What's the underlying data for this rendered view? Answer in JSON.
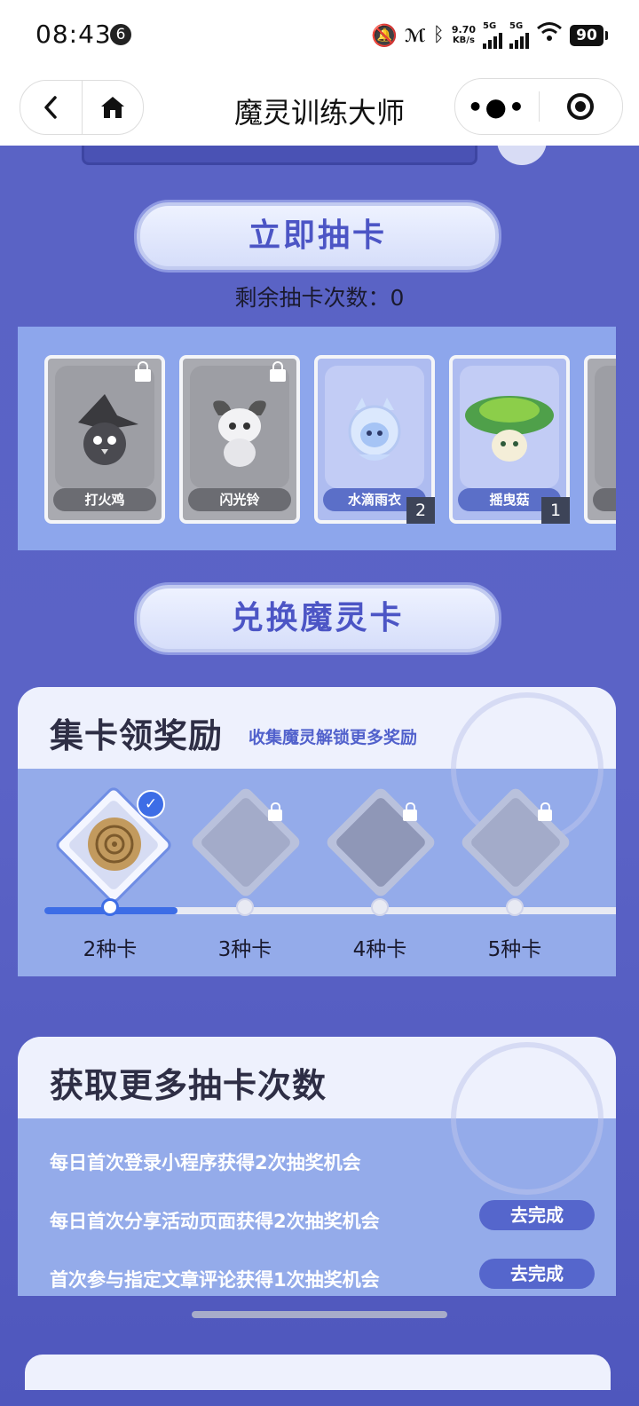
{
  "status_bar": {
    "time": "08:43",
    "notification_count": "6",
    "net_speed_value": "9.70",
    "net_speed_unit": "KB/s",
    "signal1_label": "5G",
    "signal2_label": "5G",
    "battery": "90"
  },
  "nav": {
    "title": "魔灵训练大师",
    "back_icon": "chevron-left-icon",
    "home_icon": "home-icon",
    "more_icon": "more-dots-icon",
    "close_icon": "target-icon"
  },
  "draw": {
    "button_label": "立即抽卡",
    "remaining_text": "剩余抽卡次数：0"
  },
  "cards": [
    {
      "name": "打火鸡",
      "state": "locked",
      "count": ""
    },
    {
      "name": "闪光铃",
      "state": "locked",
      "count": ""
    },
    {
      "name": "水滴雨衣",
      "state": "owned",
      "count": "2"
    },
    {
      "name": "摇曳菇",
      "state": "owned",
      "count": "1"
    }
  ],
  "exchange": {
    "button_label": "兑换魔灵卡"
  },
  "collect": {
    "title": "集卡领奖励",
    "subtitle": "收集魔灵解锁更多奖励",
    "progress_fraction": 0.23,
    "tiers": [
      {
        "label": "2种卡",
        "state": "claimed"
      },
      {
        "label": "3种卡",
        "state": "locked"
      },
      {
        "label": "4种卡",
        "state": "locked"
      },
      {
        "label": "5种卡",
        "state": "locked"
      }
    ]
  },
  "tasks": {
    "title": "获取更多抽卡次数",
    "items": [
      {
        "text": "每日首次登录小程序获得2次抽奖机会",
        "button": ""
      },
      {
        "text": "每日首次分享活动页面获得2次抽奖机会",
        "button": "去完成"
      },
      {
        "text": "首次参与指定文章评论获得1次抽奖机会",
        "button": "去完成"
      }
    ]
  },
  "colors": {
    "accent": "#3d6de6",
    "background": "#5a62c4",
    "task_button": "#5566cc"
  }
}
